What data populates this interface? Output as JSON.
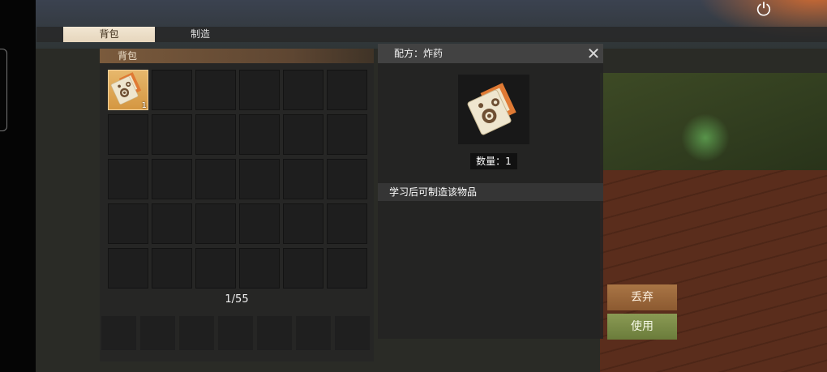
{
  "tabs": [
    {
      "label": "背包",
      "active": true
    },
    {
      "label": "制造",
      "active": false
    }
  ],
  "backpack": {
    "title": "背包",
    "capacity": "1/55",
    "grid": {
      "rows": 5,
      "cols": 6
    },
    "items": [
      {
        "slot": 0,
        "icon": "explosive-recipe-icon",
        "count": "1"
      }
    ],
    "hotbar_slots": 7
  },
  "detail": {
    "title": "配方：炸药",
    "icon": "explosive-recipe-icon",
    "quantity_label": "数量：1",
    "description": "学习后可制造该物品"
  },
  "actions": {
    "discard_label": "丢弃",
    "use_label": "使用"
  },
  "colors": {
    "tab_active": "#efe2cc",
    "panel_header": "#7a5a3c",
    "item_slot": "#e1ad63",
    "discard": "#9c6a3d",
    "use": "#7f8f4a"
  },
  "icons": {
    "power": "power-icon",
    "close": "close-icon"
  }
}
